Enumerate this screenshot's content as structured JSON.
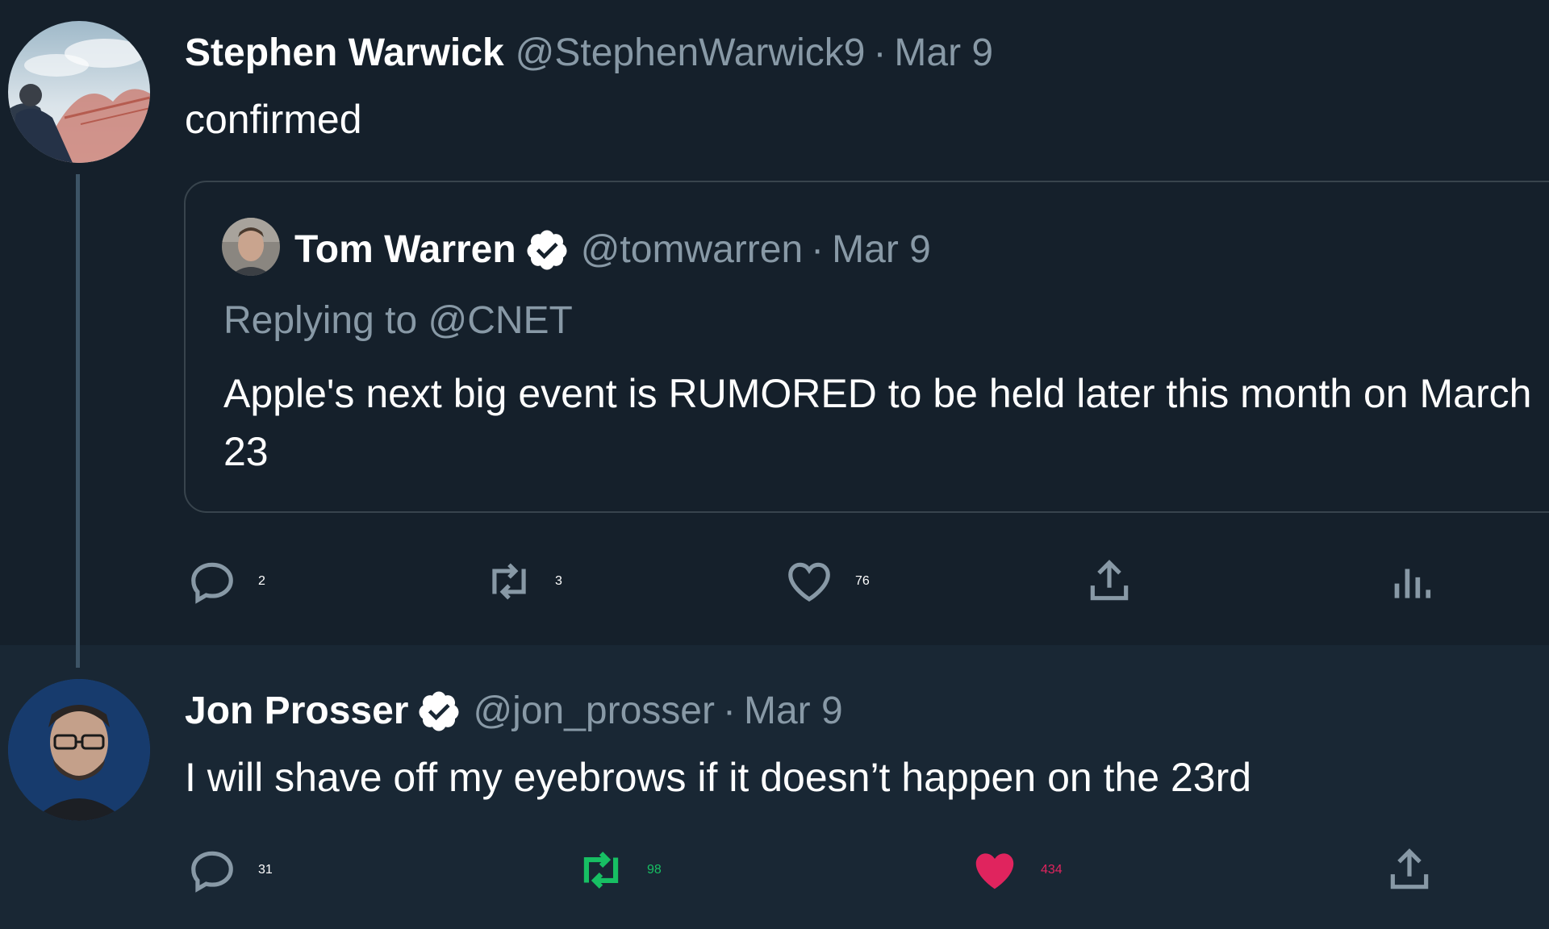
{
  "tweets": [
    {
      "author_name": "Stephen Warwick",
      "handle": "@StephenWarwick9",
      "separator": "·",
      "date": "Mar 9",
      "text": "confirmed",
      "avatar": "bridge-landscape-avatar",
      "quoted_tweet": {
        "author_name": "Tom Warren",
        "verified": true,
        "handle": "@tomwarren",
        "separator": "·",
        "date": "Mar 9",
        "replying_to": "Replying to @CNET",
        "text": "Apple's next big event is RUMORED to be held later this month on March 23"
      },
      "actions": {
        "reply_count": "2",
        "retweet_count": "3",
        "like_count": "76",
        "share_icon": "share-icon",
        "analytics_icon": "analytics-icon"
      }
    },
    {
      "author_name": "Jon Prosser",
      "verified": true,
      "handle": "@jon_prosser",
      "separator": "·",
      "date": "Mar 9",
      "text": "I will shave off my eyebrows if it doesn’t happen on the 23rd",
      "avatar": "person-glasses-avatar",
      "actions": {
        "reply_count": "31",
        "retweet_count": "98",
        "retweet_active": true,
        "like_count": "434",
        "like_active": true,
        "share_icon": "share-icon"
      }
    }
  ],
  "colors": {
    "background": "#15202b",
    "background_alt": "#192734",
    "text_primary": "#ffffff",
    "text_secondary": "#8899a6",
    "border": "#38444d",
    "retweet_active": "#17bf63",
    "like_active": "#e0245e"
  }
}
